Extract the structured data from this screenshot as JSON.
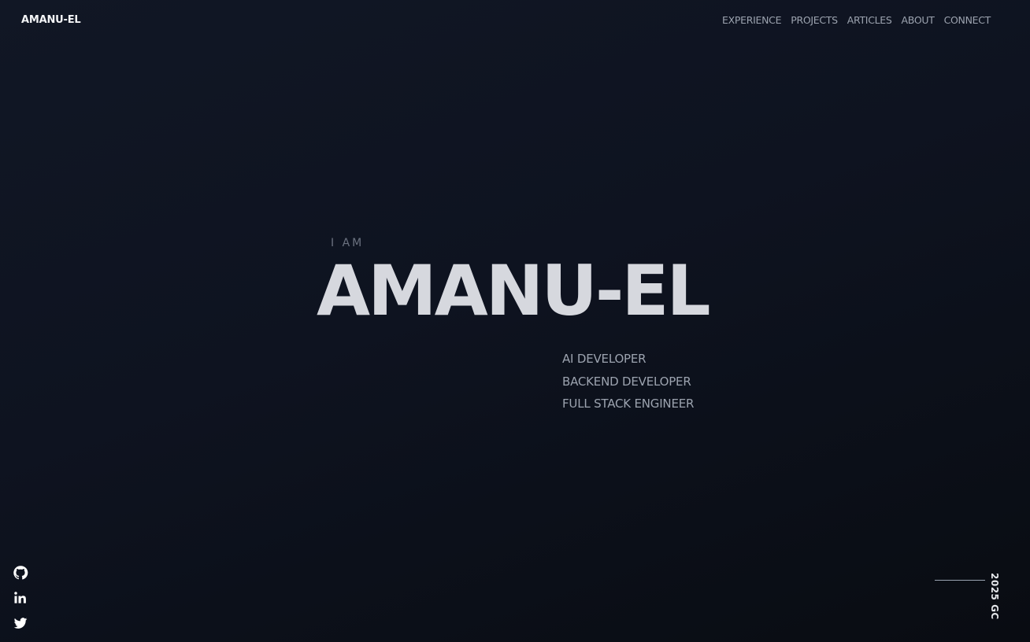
{
  "header": {
    "brand": "AMANU-EL",
    "nav": [
      {
        "label": "EXPERIENCE"
      },
      {
        "label": "PROJECTS"
      },
      {
        "label": "ARTICLES"
      },
      {
        "label": "ABOUT"
      },
      {
        "label": "CONNECT"
      }
    ]
  },
  "hero": {
    "label": "I AM",
    "name": "AMANU-EL",
    "roles": [
      "AI DEVELOPER",
      "BACKEND DEVELOPER",
      "FULL STACK ENGINEER"
    ]
  },
  "socials": [
    {
      "icon": "github-icon"
    },
    {
      "icon": "linkedin-icon"
    },
    {
      "icon": "twitter-icon"
    }
  ],
  "footer": {
    "year": "2025 GC"
  },
  "colors": {
    "background": "#0e1320",
    "text_primary": "#d6d8de",
    "text_muted": "#9ca3af"
  }
}
